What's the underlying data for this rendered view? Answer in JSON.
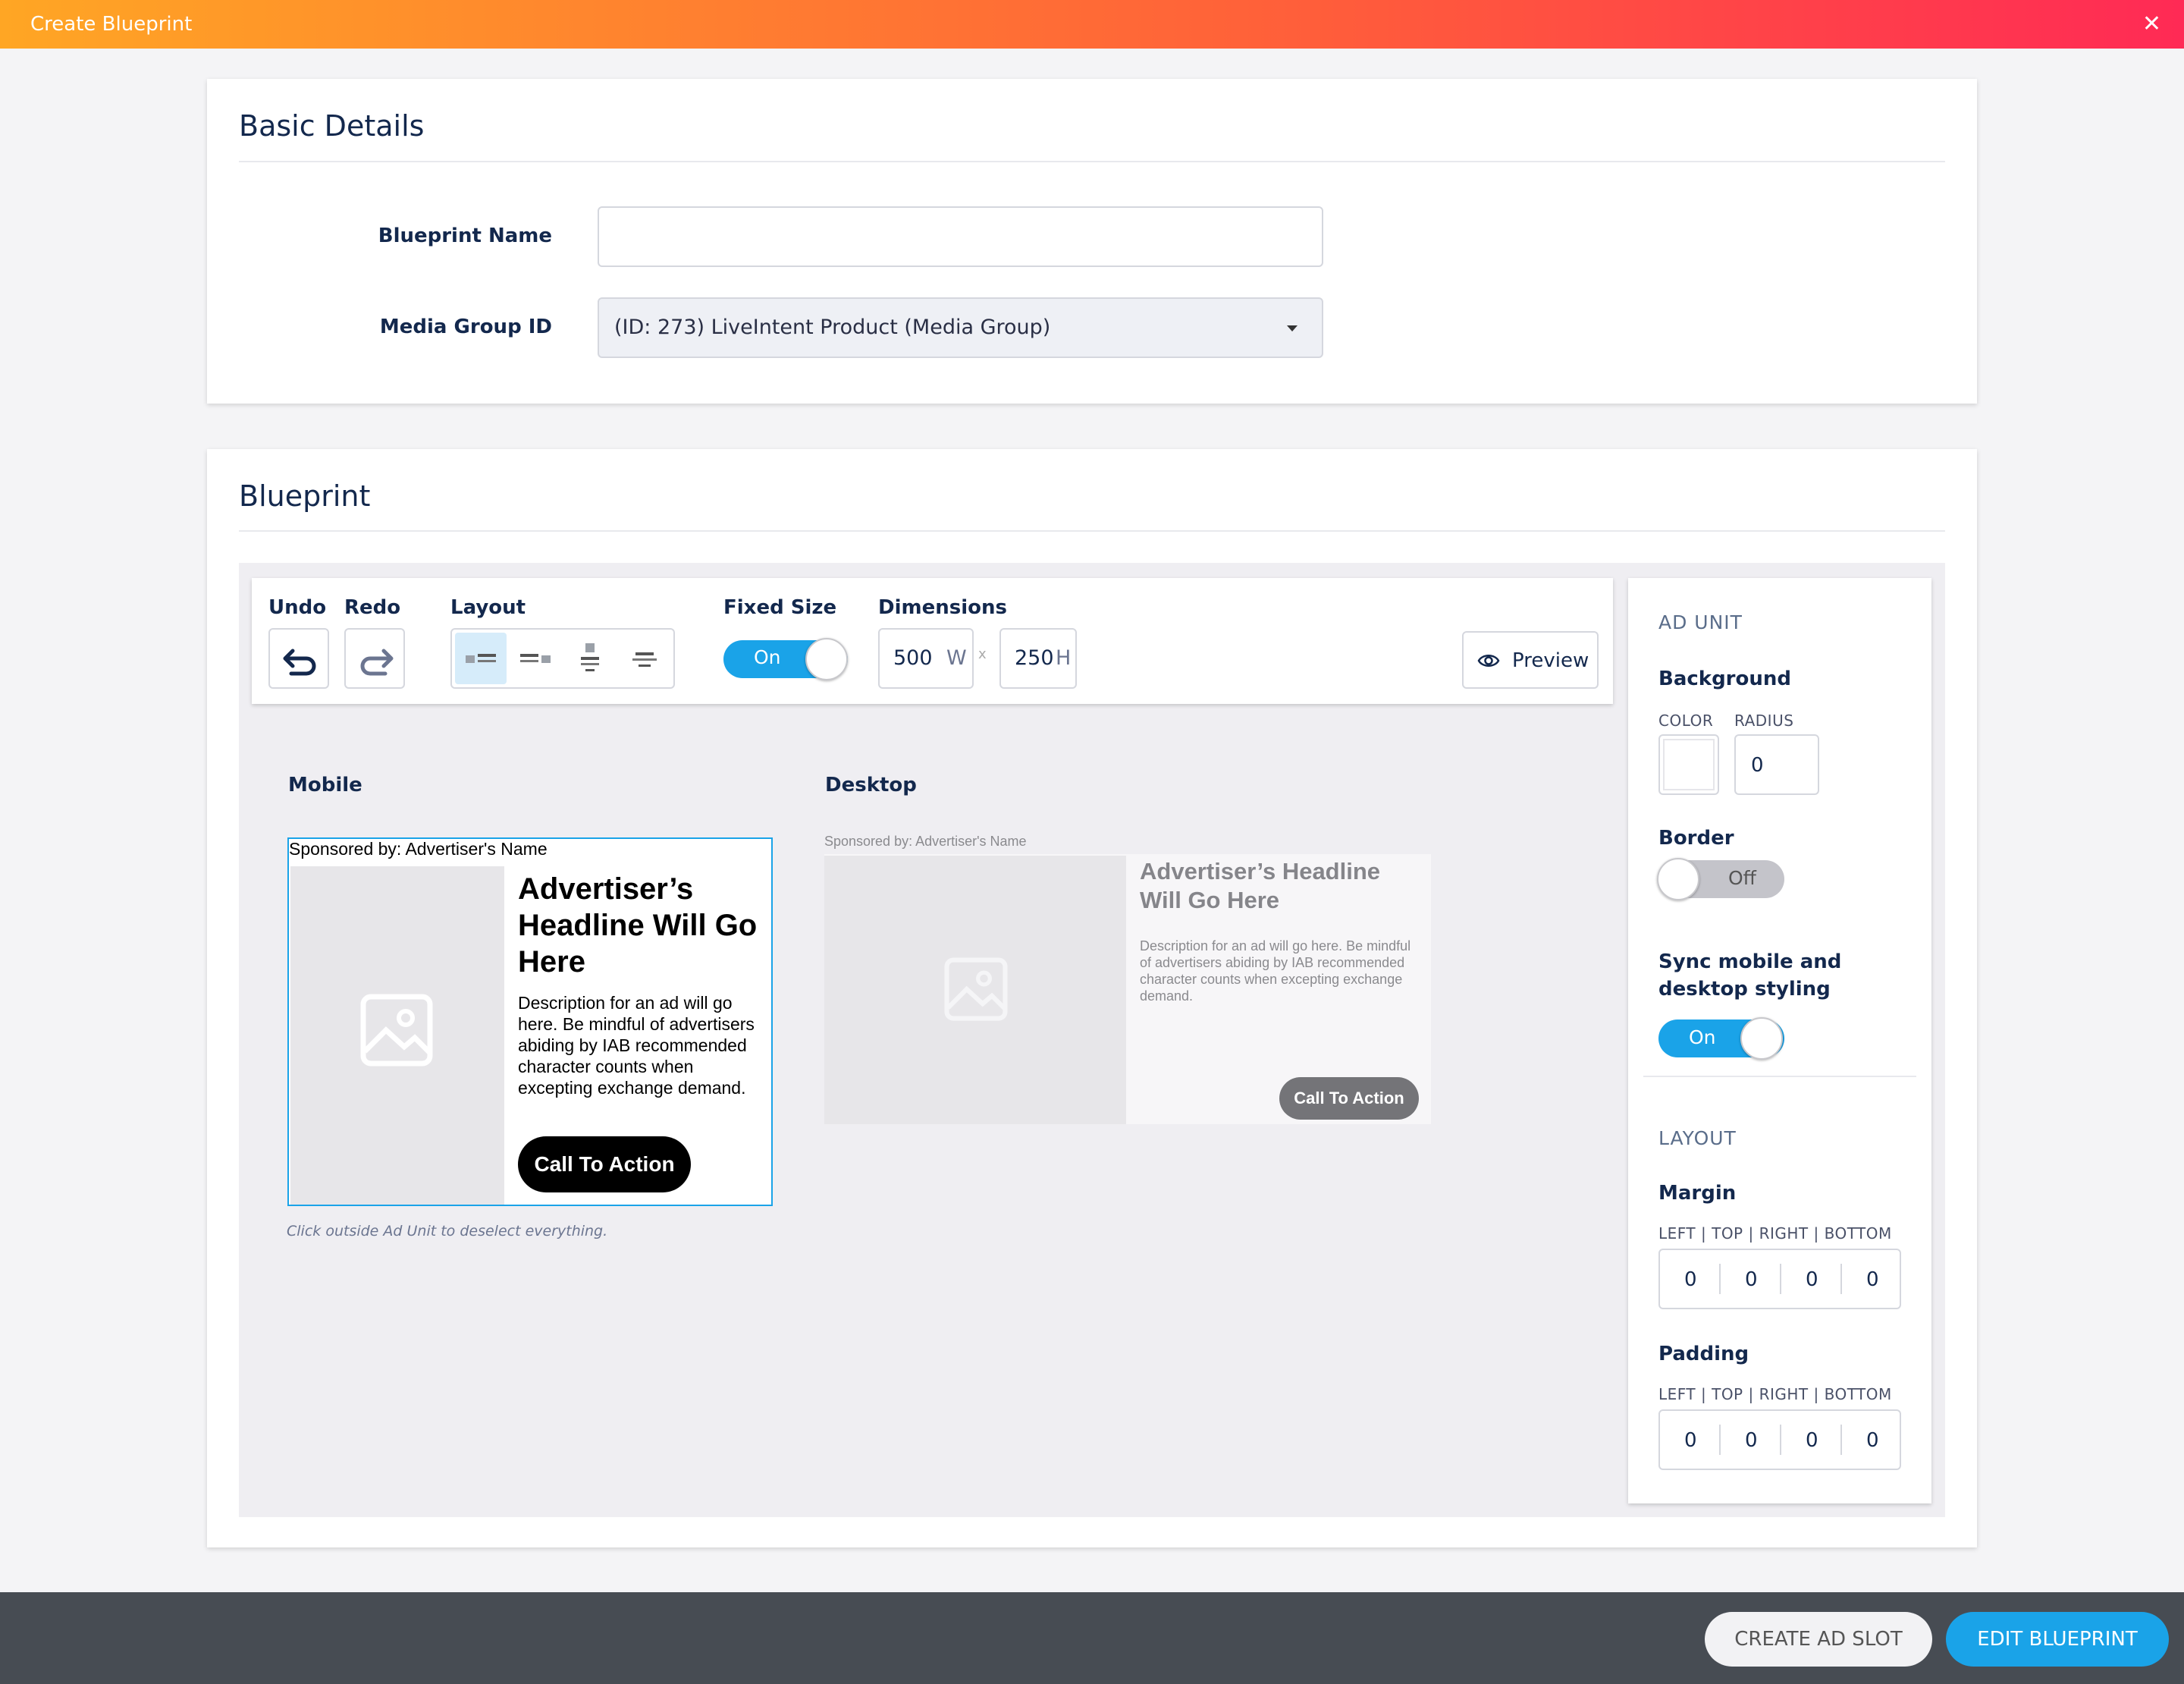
{
  "window": {
    "title": "Create Blueprint",
    "close_glyph": "✕"
  },
  "basic_details": {
    "heading": "Basic Details",
    "blueprint_name_label": "Blueprint Name",
    "blueprint_name_value": "",
    "media_group_label": "Media Group ID",
    "media_group_value": "(ID: 273) LiveIntent Product (Media Group)"
  },
  "blueprint": {
    "heading": "Blueprint",
    "toolbar": {
      "undo_label": "Undo",
      "redo_label": "Redo",
      "layout_label": "Layout",
      "fixed_size_label": "Fixed Size",
      "fixed_size_state": "On",
      "dimensions_label": "Dimensions",
      "width_value": "500",
      "width_unit": "W",
      "separator": "x",
      "height_value": "250",
      "height_unit": "H",
      "preview_label": "Preview"
    },
    "mobile": {
      "label": "Mobile",
      "sponsored": "Sponsored by: Advertiser's Name",
      "headline": "Advertiser’s Headline Will Go Here",
      "description": "Description for an ad will go here. Be mindful of advertisers abiding by IAB recommended character counts when excepting exchange demand.",
      "cta": "Call To Action",
      "hint": "Click outside Ad Unit to deselect everything."
    },
    "desktop": {
      "label": "Desktop",
      "sponsored": "Sponsored by: Advertiser's Name",
      "headline": "Advertiser’s Headline Will Go Here",
      "description": "Description for an ad will go here. Be mindful of advertisers abiding by IAB recommended character counts when excepting exchange demand.",
      "cta": "Call To Action"
    },
    "side_panel": {
      "ad_unit_heading": "AD UNIT",
      "background_label": "Background",
      "color_label": "COLOR",
      "radius_label": "RADIUS",
      "radius_value": "0",
      "border_label": "Border",
      "border_state": "Off",
      "sync_label": "Sync mobile and desktop styling",
      "sync_state": "On",
      "layout_heading": "LAYOUT",
      "margin_label": "Margin",
      "margin_sides": "LEFT | TOP | RIGHT | BOTTOM",
      "margin_values": [
        "0",
        "0",
        "0",
        "0"
      ],
      "padding_label": "Padding",
      "padding_sides": "LEFT | TOP | RIGHT | BOTTOM",
      "padding_values": [
        "0",
        "0",
        "0",
        "0"
      ]
    }
  },
  "footer": {
    "create_ad_slot": "CREATE AD SLOT",
    "edit_blueprint": "EDIT BLUEPRINT"
  },
  "colors": {
    "accent_blue": "#1aa3e8",
    "dark_navy": "#13284d",
    "footer_bg": "#474c53"
  }
}
